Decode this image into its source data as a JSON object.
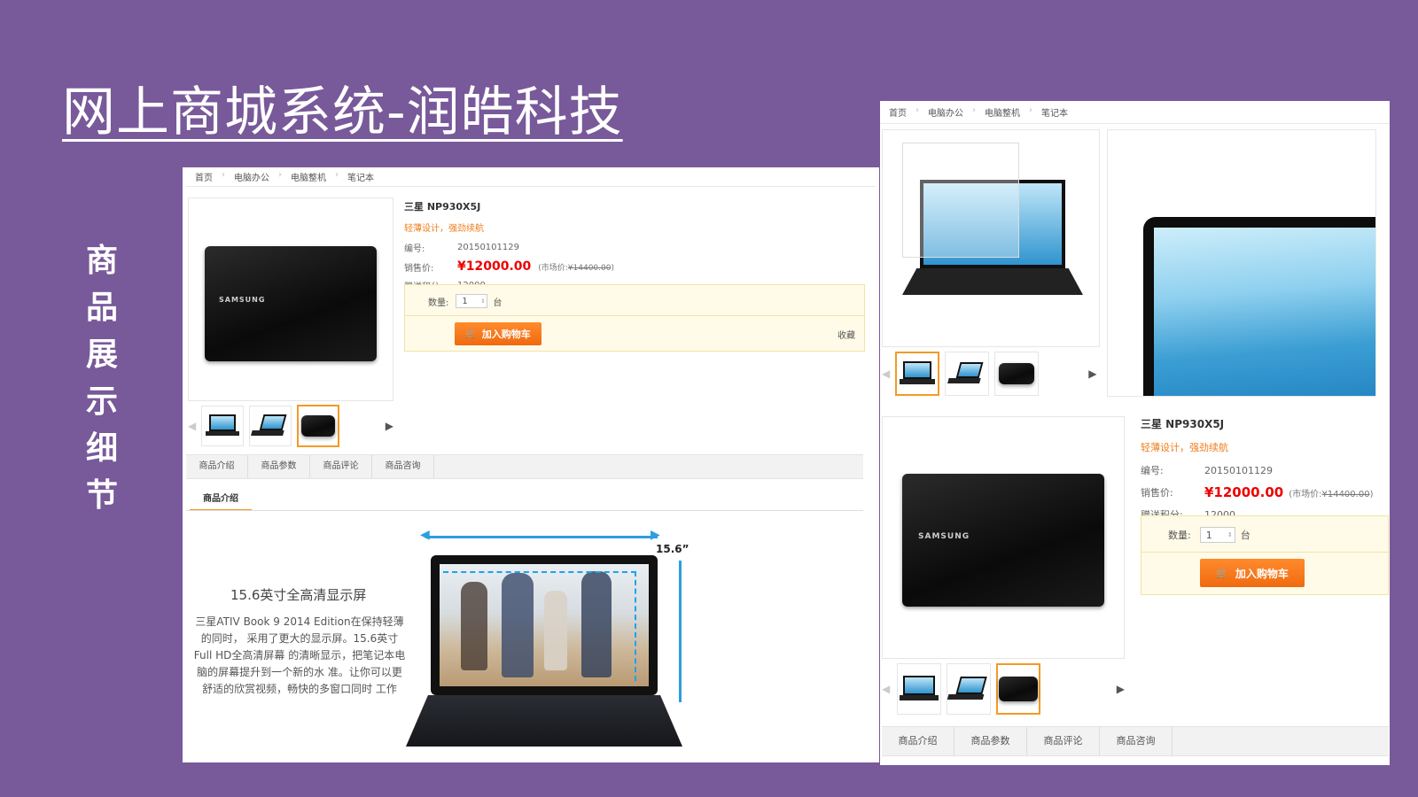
{
  "slide": {
    "title": "网上商城系统-润皓科技",
    "side_caption": [
      "商",
      "品",
      "展",
      "示",
      "细",
      "节"
    ]
  },
  "breadcrumb": [
    "首页",
    "电脑办公",
    "电脑整机",
    "笔记本"
  ],
  "product": {
    "name": "三星 NP930X5J",
    "slogan": "轻薄设计，强劲续航",
    "code_label": "编号:",
    "code": "20150101129",
    "price_label": "销售价:",
    "price": "¥12000.00",
    "market_prefix": "(市场价:",
    "market_price": "¥14400.00",
    "market_suffix": ")",
    "points_label": "赠送积分:",
    "points": "12000",
    "qty_label": "数量:",
    "qty_value": "1",
    "qty_unit": "台",
    "add_to_cart": "加入购物车",
    "favorite": "收藏",
    "brand": "SAMSUNG"
  },
  "tabs": [
    "商品介绍",
    "商品参数",
    "商品评论",
    "商品咨询"
  ],
  "active_subtab": "商品介绍",
  "feature": {
    "size_label": "15.6”",
    "title": "15.6英寸全高清显示屏",
    "text": "三星ATIV Book 9 2014 Edition在保持轻薄的同时， 采用了更大的显示屏。15.6英寸Full HD全高清屏幕 的清晰显示，把笔记本电脑的屏幕提升到一个新的水 准。让你可以更舒适的欣赏视频，畅快的多窗口同时 工作"
  },
  "icons": {
    "cart": "cart-icon",
    "prev": "chevron-left-icon",
    "next": "chevron-right-icon"
  },
  "colors": {
    "background": "#78599a",
    "accent": "#f39a26",
    "price": "#e00000"
  }
}
